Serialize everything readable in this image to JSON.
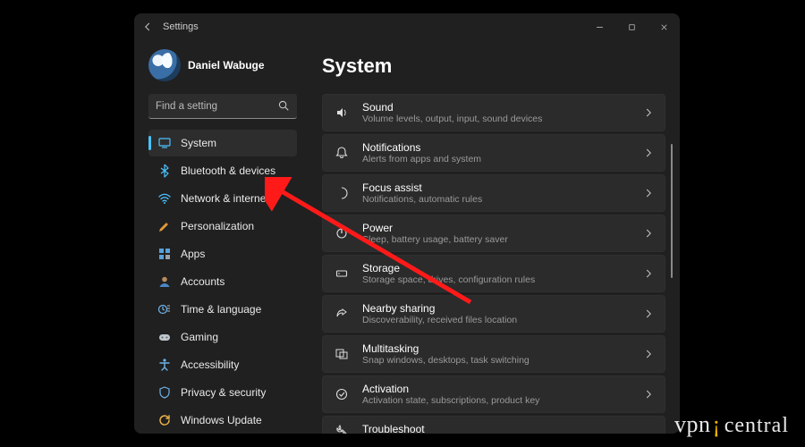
{
  "window": {
    "app_title": "Settings"
  },
  "user": {
    "name": "Daniel Wabuge"
  },
  "search": {
    "placeholder": "Find a setting"
  },
  "sidebar": {
    "items": [
      {
        "label": "System",
        "icon": "system-icon",
        "active": true
      },
      {
        "label": "Bluetooth & devices",
        "icon": "bluetooth-icon"
      },
      {
        "label": "Network & internet",
        "icon": "wifi-icon"
      },
      {
        "label": "Personalization",
        "icon": "personalization-icon"
      },
      {
        "label": "Apps",
        "icon": "apps-icon"
      },
      {
        "label": "Accounts",
        "icon": "accounts-icon"
      },
      {
        "label": "Time & language",
        "icon": "time-language-icon"
      },
      {
        "label": "Gaming",
        "icon": "gaming-icon"
      },
      {
        "label": "Accessibility",
        "icon": "accessibility-icon"
      },
      {
        "label": "Privacy & security",
        "icon": "privacy-icon"
      },
      {
        "label": "Windows Update",
        "icon": "update-icon"
      }
    ]
  },
  "page": {
    "title": "System",
    "items": [
      {
        "title": "Sound",
        "desc": "Volume levels, output, input, sound devices",
        "icon": "sound-icon"
      },
      {
        "title": "Notifications",
        "desc": "Alerts from apps and system",
        "icon": "notifications-icon"
      },
      {
        "title": "Focus assist",
        "desc": "Notifications, automatic rules",
        "icon": "focus-icon"
      },
      {
        "title": "Power",
        "desc": "Sleep, battery usage, battery saver",
        "icon": "power-icon"
      },
      {
        "title": "Storage",
        "desc": "Storage space, drives, configuration rules",
        "icon": "storage-icon"
      },
      {
        "title": "Nearby sharing",
        "desc": "Discoverability, received files location",
        "icon": "share-icon"
      },
      {
        "title": "Multitasking",
        "desc": "Snap windows, desktops, task switching",
        "icon": "multitask-icon"
      },
      {
        "title": "Activation",
        "desc": "Activation state, subscriptions, product key",
        "icon": "activation-icon"
      },
      {
        "title": "Troubleshoot",
        "desc": "",
        "icon": "troubleshoot-icon"
      }
    ]
  },
  "watermark": {
    "part1": "vpn",
    "part2": "central"
  }
}
